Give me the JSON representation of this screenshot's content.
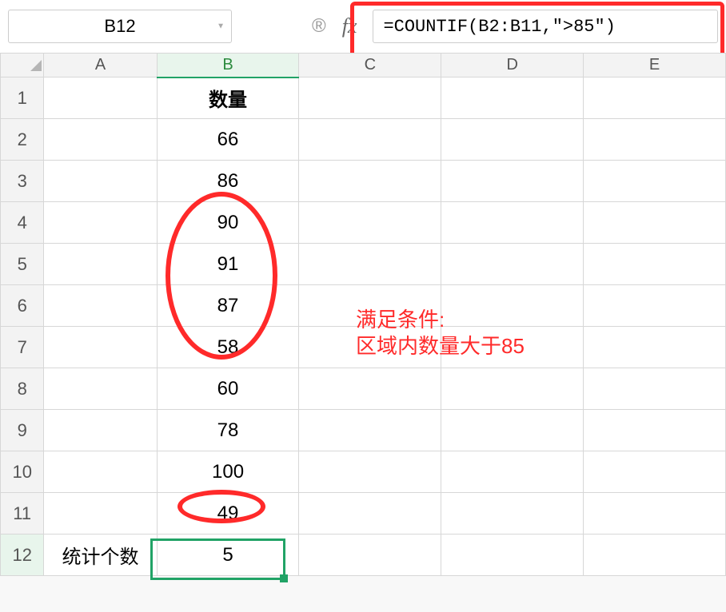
{
  "name_box": "B12",
  "formula": "=COUNTIF(B2:B11,\">85\")",
  "fx_label": "fx",
  "columns": [
    "A",
    "B",
    "C",
    "D",
    "E"
  ],
  "row_numbers": [
    "1",
    "2",
    "3",
    "4",
    "5",
    "6",
    "7",
    "8",
    "9",
    "10",
    "11",
    "12"
  ],
  "cells": {
    "B1": "数量",
    "B2": "66",
    "B3": "86",
    "B4": "90",
    "B5": "91",
    "B6": "87",
    "B7": "58",
    "B8": "60",
    "B9": "78",
    "B10": "100",
    "B11": "49",
    "A12": "统计个数",
    "B12": "5"
  },
  "annotation": {
    "line1": "满足条件:",
    "line2": "区域内数量大于85"
  },
  "chart_data": {
    "type": "table",
    "title": "数量",
    "categories": [
      "B2",
      "B3",
      "B4",
      "B5",
      "B6",
      "B7",
      "B8",
      "B9",
      "B10",
      "B11"
    ],
    "values": [
      66,
      86,
      90,
      91,
      87,
      58,
      60,
      78,
      100,
      49
    ],
    "summary": {
      "label": "统计个数",
      "condition": ">85",
      "count": 5
    }
  }
}
